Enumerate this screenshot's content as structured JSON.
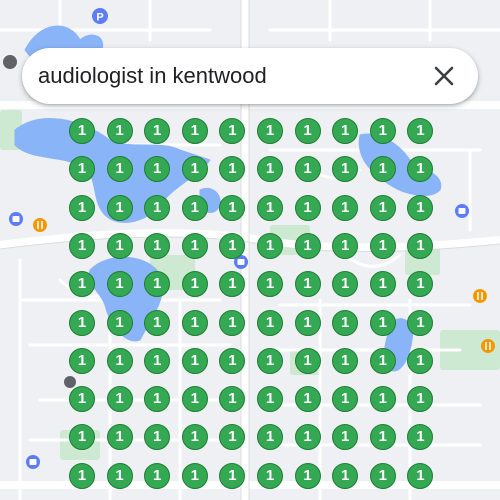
{
  "search": {
    "query": "audiologist in kentwood"
  },
  "icons": {
    "clear": "close-icon",
    "poi": [
      "parking-icon",
      "shopping-icon",
      "restaurant-icon",
      "pin-icon"
    ]
  },
  "grid": {
    "rows": 10,
    "cols": 10,
    "rank_labels": [
      [
        "1",
        "1",
        "1",
        "1",
        "1",
        "1",
        "1",
        "1",
        "1",
        "1"
      ],
      [
        "1",
        "1",
        "1",
        "1",
        "1",
        "1",
        "1",
        "1",
        "1",
        "1"
      ],
      [
        "1",
        "1",
        "1",
        "1",
        "1",
        "1",
        "1",
        "1",
        "1",
        "1"
      ],
      [
        "1",
        "1",
        "1",
        "1",
        "1",
        "1",
        "1",
        "1",
        "1",
        "1"
      ],
      [
        "1",
        "1",
        "1",
        "1",
        "1",
        "1",
        "1",
        "1",
        "1",
        "1"
      ],
      [
        "1",
        "1",
        "1",
        "1",
        "1",
        "1",
        "1",
        "1",
        "1",
        "1"
      ],
      [
        "1",
        "1",
        "1",
        "1",
        "1",
        "1",
        "1",
        "1",
        "1",
        "1"
      ],
      [
        "1",
        "1",
        "1",
        "1",
        "1",
        "1",
        "1",
        "1",
        "1",
        "1"
      ],
      [
        "1",
        "1",
        "1",
        "1",
        "1",
        "1",
        "1",
        "1",
        "1",
        "1"
      ],
      [
        "1",
        "1",
        "1",
        "1",
        "1",
        "1",
        "1",
        "1",
        "1",
        "1"
      ]
    ]
  },
  "colors": {
    "pin_fill": "#34a853",
    "pin_text": "#ffffff",
    "water": "#8ab4f8",
    "park": "#cde9d2",
    "road": "#ffffff",
    "land": "#eef0f3",
    "poi_blue": "#5c7cfa",
    "poi_orange": "#f29900"
  }
}
